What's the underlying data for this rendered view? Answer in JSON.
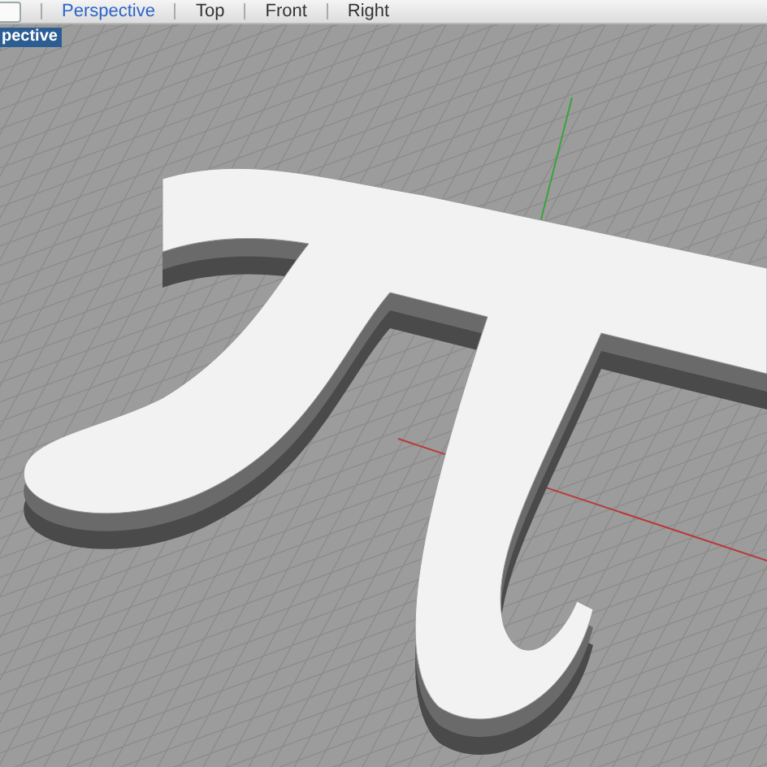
{
  "toolbar": {
    "tabs": [
      {
        "label": "Perspective",
        "selected": true
      },
      {
        "label": "Top",
        "selected": false
      },
      {
        "label": "Front",
        "selected": false
      },
      {
        "label": "Right",
        "selected": false
      }
    ]
  },
  "viewport": {
    "label": "pective"
  }
}
